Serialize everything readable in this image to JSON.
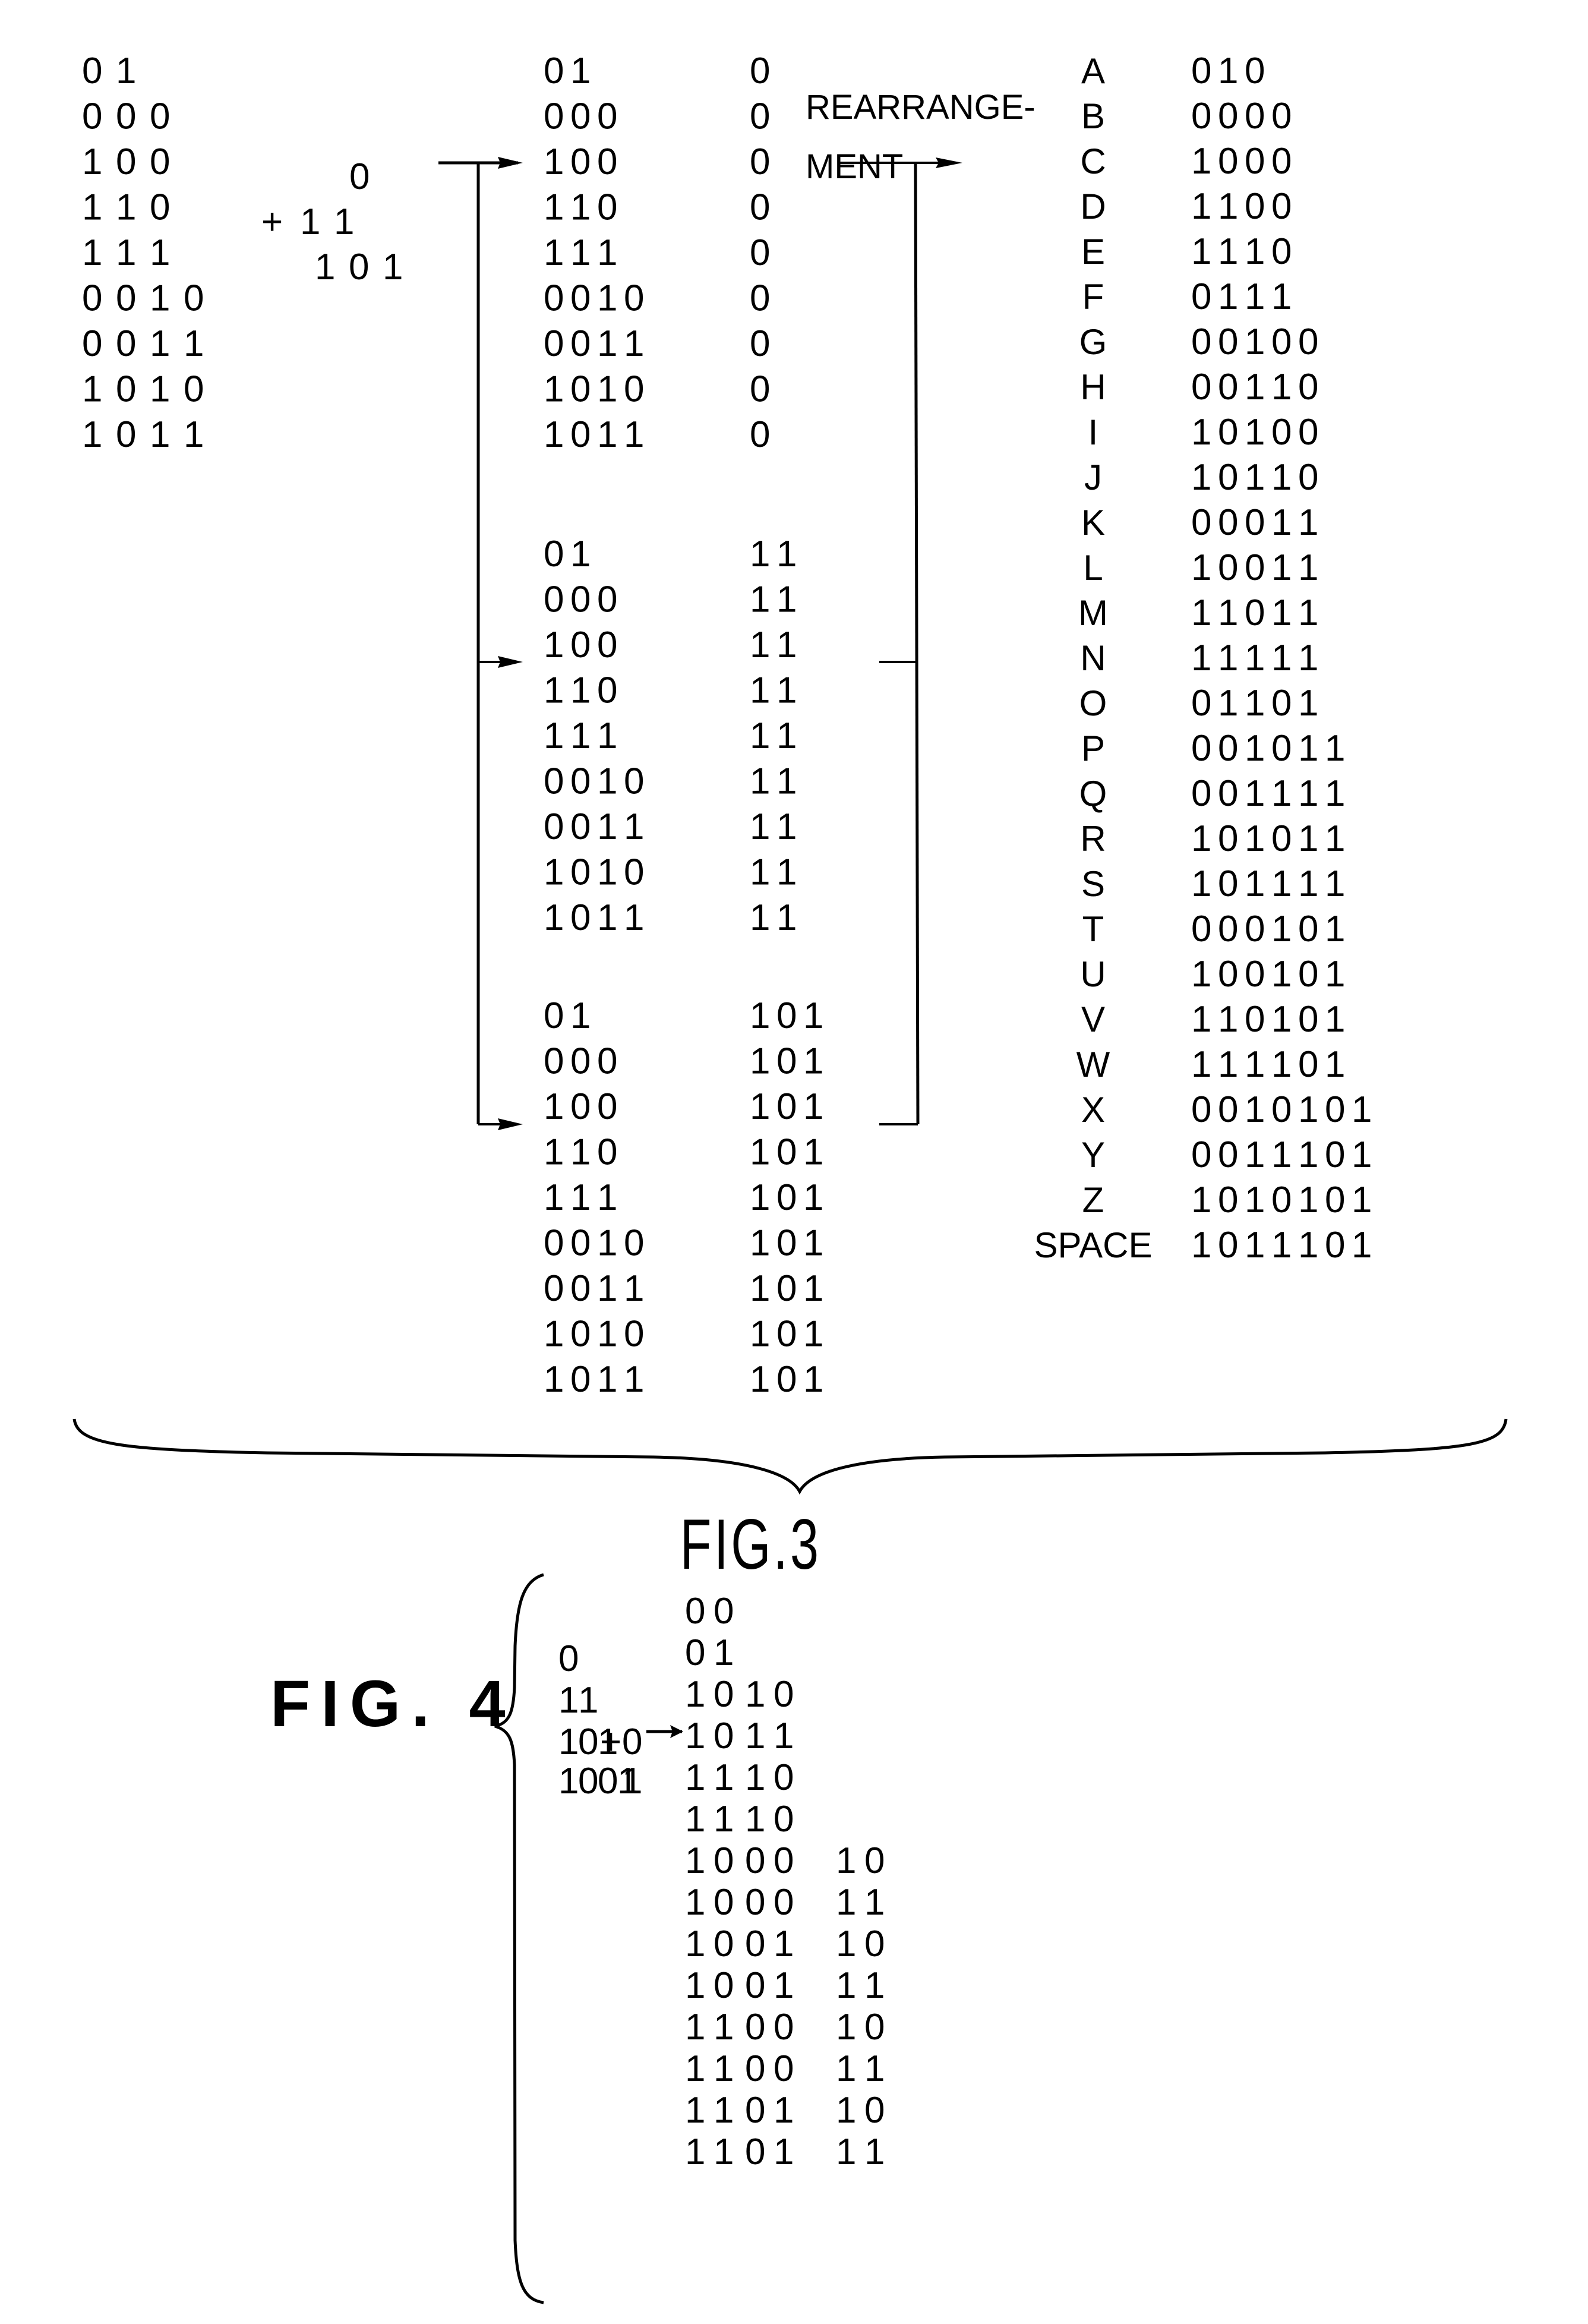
{
  "fig3": {
    "caption": "FIG.3",
    "input_codes": [
      "0 1",
      "0 0 0",
      "1 0 0",
      "1 1 0",
      "1 1 1",
      "0 0 1 0",
      "0 0 1 1",
      "1 0 1 0",
      "1 0 1 1"
    ],
    "plus_sign": "+",
    "added_suffixes": [
      "0",
      "1 1",
      "1 0 1"
    ],
    "groups": [
      {
        "prefixes": [
          "0 1",
          "0 0 0",
          "1 0 0",
          "1 1 0",
          "1 1 1",
          "0 0 1 0",
          "0 0 1 1",
          "1 0 1 0",
          "1 0 1 1"
        ],
        "suffix": "0"
      },
      {
        "prefixes": [
          "0 1",
          "0 0 0",
          "1 0 0",
          "1 1 0",
          "1 1 1",
          "0 0 1 0",
          "0 0 1 1",
          "1 0 1 0",
          "1 0 1 1"
        ],
        "suffix": "1 1"
      },
      {
        "prefixes": [
          "0 1",
          "0 0 0",
          "1 0 0",
          "1 1 0",
          "1 1 1",
          "0 0 1 0",
          "0 0 1 1",
          "1 0 1 0",
          "1 0 1 1"
        ],
        "suffix": "1 0 1"
      }
    ],
    "rearrangement_label_line1": "REARRANGE-",
    "rearrangement_label_line2": "MENT",
    "code_table": [
      {
        "char": "A",
        "code": "0 1 0"
      },
      {
        "char": "B",
        "code": "0 0 0 0"
      },
      {
        "char": "C",
        "code": "1 0 0 0"
      },
      {
        "char": "D",
        "code": "1 1 0 0"
      },
      {
        "char": "E",
        "code": "1 1 1 0"
      },
      {
        "char": "F",
        "code": "0 1 1 1"
      },
      {
        "char": "G",
        "code": "0 0 1 0 0"
      },
      {
        "char": "H",
        "code": "0 0 1 1 0"
      },
      {
        "char": "I",
        "code": "1 0 1 0 0"
      },
      {
        "char": "J",
        "code": "1 0 1 1 0"
      },
      {
        "char": "K",
        "code": "0 0 0 1 1"
      },
      {
        "char": "L",
        "code": "1 0 0 1 1"
      },
      {
        "char": "M",
        "code": "1 1 0 1 1"
      },
      {
        "char": "N",
        "code": "1 1 1 1 1"
      },
      {
        "char": "O",
        "code": "0 1 1 0 1"
      },
      {
        "char": "P",
        "code": "0 0 1 0 1 1"
      },
      {
        "char": "Q",
        "code": "0 0 1 1 1 1"
      },
      {
        "char": "R",
        "code": "1 0 1 0 1 1"
      },
      {
        "char": "S",
        "code": "1 0 1 1 1 1"
      },
      {
        "char": "T",
        "code": "0 0 0 1 0 1"
      },
      {
        "char": "U",
        "code": "1 0 0 1 0 1"
      },
      {
        "char": "V",
        "code": "1 1 0 1 0 1"
      },
      {
        "char": "W",
        "code": "1 1 1 1 0 1"
      },
      {
        "char": "X",
        "code": "0 0 1 0 1 0 1"
      },
      {
        "char": "Y",
        "code": "0 0 1 1 1 0 1"
      },
      {
        "char": "Z",
        "code": "1 0 1 0 1 0 1"
      },
      {
        "char": "SPACE",
        "code": "1 0 1 1 1 0 1"
      }
    ]
  },
  "fig4": {
    "caption": "FIG. 4",
    "input_codes": [
      "0",
      "1 1",
      "1 0 1",
      "1 0 0 1"
    ],
    "plus_sign": "+",
    "added_bits": [
      "0",
      "1"
    ],
    "output_rows": [
      [
        "0 0",
        "",
        ""
      ],
      [
        "0 1",
        "",
        ""
      ],
      [
        "1 0",
        "1 0",
        ""
      ],
      [
        "1 0",
        "1 1",
        ""
      ],
      [
        "1 1",
        "1 0",
        ""
      ],
      [
        "1 1",
        "1 0",
        ""
      ],
      [
        "1 0",
        "0 0",
        "1 0"
      ],
      [
        "1 0",
        "0 0",
        "1 1"
      ],
      [
        "1 0",
        "0 1",
        "1 0"
      ],
      [
        "1 0",
        "0 1",
        "1 1"
      ],
      [
        "1 1",
        "0 0",
        "1 0"
      ],
      [
        "1 1",
        "0 0",
        "1 1"
      ],
      [
        "1 1",
        "0 1",
        "1 0"
      ],
      [
        "1 1",
        "0 1",
        "1 1"
      ]
    ]
  }
}
